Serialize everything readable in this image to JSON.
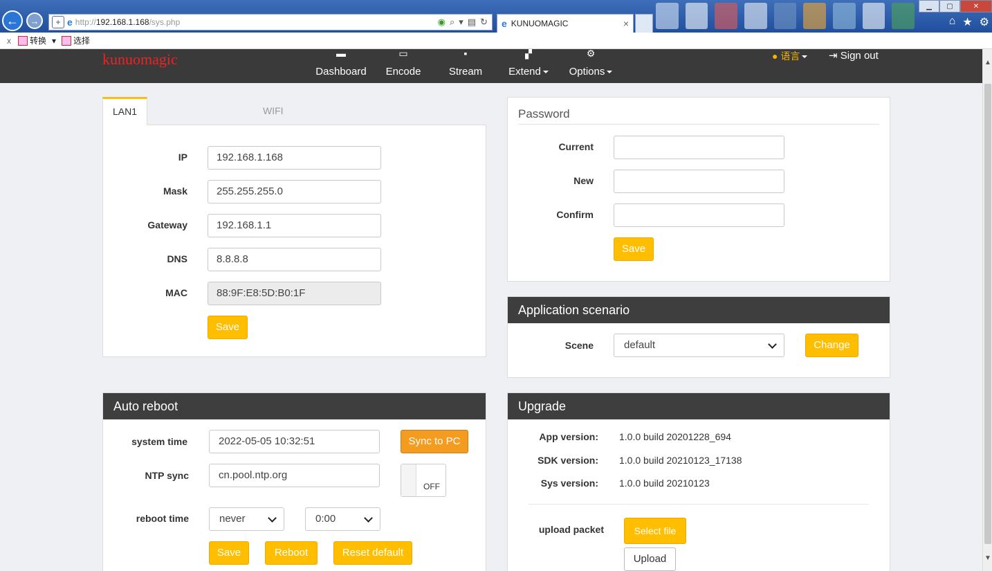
{
  "browser": {
    "url_prefix": "http://",
    "url_host": "192.168.1.168",
    "url_path": "/sys.php",
    "tab_title": "KUNUOMAGIC",
    "cmd_convert": "转换",
    "cmd_select": "选择",
    "close_glyph": "×",
    "x_glyph": "x"
  },
  "nav": {
    "brand": "kunuomagic",
    "items": [
      {
        "label": "Dashboard"
      },
      {
        "label": "Encode"
      },
      {
        "label": "Stream"
      },
      {
        "label": "Extend"
      },
      {
        "label": "Options"
      }
    ],
    "language": "语言",
    "signout": "Sign out"
  },
  "network": {
    "tabs": [
      "LAN1",
      "WIFI"
    ],
    "fields": [
      {
        "label": "IP",
        "value": "192.168.1.168"
      },
      {
        "label": "Mask",
        "value": "255.255.255.0"
      },
      {
        "label": "Gateway",
        "value": "192.168.1.1"
      },
      {
        "label": "DNS",
        "value": "8.8.8.8"
      },
      {
        "label": "MAC",
        "value": "88:9F:E8:5D:B0:1F"
      }
    ],
    "save_label": "Save"
  },
  "password": {
    "title": "Password",
    "fields": [
      {
        "label": "Current",
        "value": ""
      },
      {
        "label": "New",
        "value": ""
      },
      {
        "label": "Confirm",
        "value": ""
      }
    ],
    "save_label": "Save"
  },
  "scenario": {
    "title": "Application scenario",
    "scene_label": "Scene",
    "scene_value": "default",
    "change_label": "Change"
  },
  "reboot": {
    "title": "Auto reboot",
    "system_time_label": "system time",
    "system_time_value": "2022-05-05 10:32:51",
    "sync_label": "Sync to PC",
    "ntp_label": "NTP sync",
    "ntp_value": "cn.pool.ntp.org",
    "ntp_toggle": "OFF",
    "reboot_time_label": "reboot time",
    "reboot_freq": "never",
    "reboot_hour": "0:00",
    "save_label": "Save",
    "reboot_label": "Reboot",
    "reset_label": "Reset default"
  },
  "upgrade": {
    "title": "Upgrade",
    "rows": [
      {
        "label": "App version:",
        "value": "1.0.0 build 20201228_694"
      },
      {
        "label": "SDK version:",
        "value": "1.0.0 build 20210123_17138"
      },
      {
        "label": "Sys version:",
        "value": "1.0.0 build 20210123"
      }
    ],
    "upload_packet_label": "upload packet",
    "select_file_label": "Select file",
    "upload_label": "Upload"
  },
  "colors": {
    "accent": "#ffbe00",
    "nav_bg": "#3a3a3a",
    "sync_button": "#f39c1f",
    "brand": "#ee2222"
  }
}
